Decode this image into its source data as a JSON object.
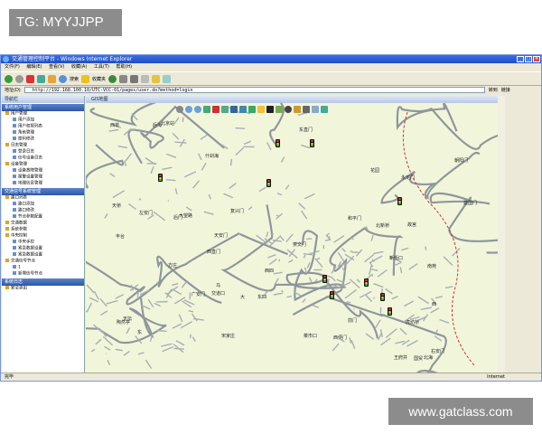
{
  "overlay": {
    "top_tag": "TG: MYYJJPP",
    "bottom_tag": "www.gatclass.com"
  },
  "window": {
    "title": "交通管理控制平台 - Windows Internet Explorer",
    "menu": [
      "文件(F)",
      "编辑(E)",
      "查看(V)",
      "收藏(A)",
      "工具(T)",
      "帮助(H)"
    ],
    "toolbar": {
      "search": "搜索",
      "favorites": "收藏夹"
    },
    "address_label": "地址(D)",
    "address_value": "http://192.168.100.10/UTC-VCC-01/pages/user.do?method=login",
    "go_label": "转到",
    "links_label": "链接"
  },
  "sidebar": {
    "header": "导航栏",
    "sections": [
      {
        "title": "系统用户管理",
        "items": [
          {
            "level": 1,
            "label": "用户管理"
          },
          {
            "level": 2,
            "label": "用户添加"
          },
          {
            "level": 2,
            "label": "用户权限列表"
          },
          {
            "level": 2,
            "label": "角色管理"
          },
          {
            "level": 2,
            "label": "密码修改"
          },
          {
            "level": 1,
            "label": "日志管理"
          },
          {
            "level": 2,
            "label": "登录日志"
          },
          {
            "level": 2,
            "label": "信号设备日志"
          },
          {
            "level": 1,
            "label": "设备管理"
          },
          {
            "level": 2,
            "label": "设备故障管理"
          },
          {
            "level": 2,
            "label": "报警设置管理"
          },
          {
            "level": 2,
            "label": "地理信息管理"
          }
        ]
      },
      {
        "title": "交通信号系统管理",
        "items": [
          {
            "level": 1,
            "label": "路口列表"
          },
          {
            "level": 2,
            "label": "路口添加"
          },
          {
            "level": 2,
            "label": "路口修改"
          },
          {
            "level": 2,
            "label": "节点参数配置"
          },
          {
            "level": 1,
            "label": "交通数据"
          },
          {
            "level": 1,
            "label": "系统参数"
          },
          {
            "level": 1,
            "label": "中央控制"
          },
          {
            "level": 2,
            "label": "中央手控"
          },
          {
            "level": 2,
            "label": "紧急数据设置"
          },
          {
            "level": 2,
            "label": "紧急数据设置"
          },
          {
            "level": 1,
            "label": "交通信号节点"
          },
          {
            "level": 2,
            "label": "1"
          },
          {
            "level": 2,
            "label": "新增信号节点"
          }
        ]
      },
      {
        "title": "系统日志",
        "items": [
          {
            "level": 1,
            "label": "安全退出"
          }
        ]
      }
    ]
  },
  "map": {
    "title": "GIS地图",
    "labels": [
      "西四",
      "后门",
      "后海",
      "新街口",
      "北海",
      "什刹海",
      "东四",
      "西直门",
      "交道口",
      "北新桥",
      "故宫",
      "东直门",
      "西单",
      "王府井",
      "天安门",
      "前门",
      "崇文门",
      "建国门",
      "朝阳门",
      "复兴门",
      "国贸",
      "大望路",
      "西便门",
      "广安门",
      "虎坊桥",
      "和平门",
      "菜市口",
      "天坛",
      "永定门",
      "陶然亭",
      "马",
      "大",
      "东",
      "西",
      "花园",
      "天桥",
      "左安门",
      "北京站",
      "方庄",
      "宋家庄",
      "丰台",
      "右安门",
      "南苑"
    ]
  },
  "status": {
    "left": "完毕",
    "right": "Internet"
  }
}
